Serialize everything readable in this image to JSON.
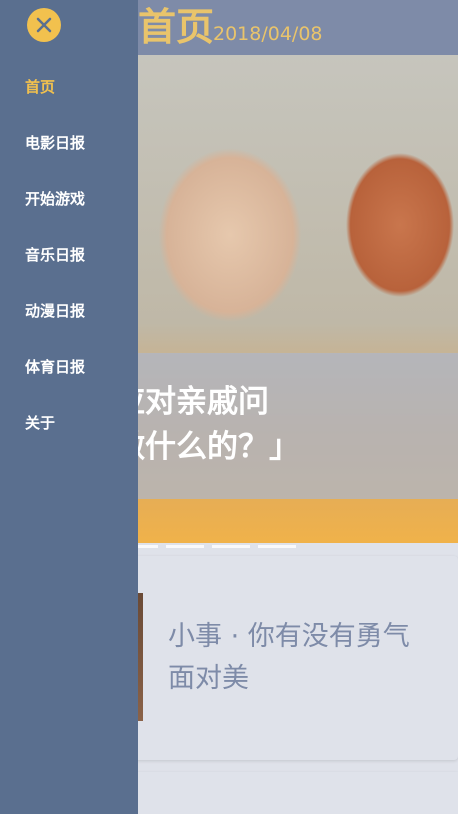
{
  "header": {
    "title": "首页",
    "date": "2018/04/08"
  },
  "banner": {
    "caption_line1": "智地应对亲戚问",
    "caption_line2": "业是做什么的？」"
  },
  "story": {
    "title": "小事 · 你有没有勇气面对美"
  },
  "drawer": {
    "close_icon": "close-icon",
    "items": [
      {
        "label": "首页",
        "active": true
      },
      {
        "label": "电影日报"
      },
      {
        "label": "开始游戏"
      },
      {
        "label": "音乐日报"
      },
      {
        "label": "动漫日报"
      },
      {
        "label": "体育日报"
      },
      {
        "label": "关于"
      }
    ]
  },
  "colors": {
    "accent": "#f2c14e",
    "drawer_bg": "#5a6f8f",
    "header_bg": "#7e8ba8",
    "story_title": "#7e8ba8"
  }
}
